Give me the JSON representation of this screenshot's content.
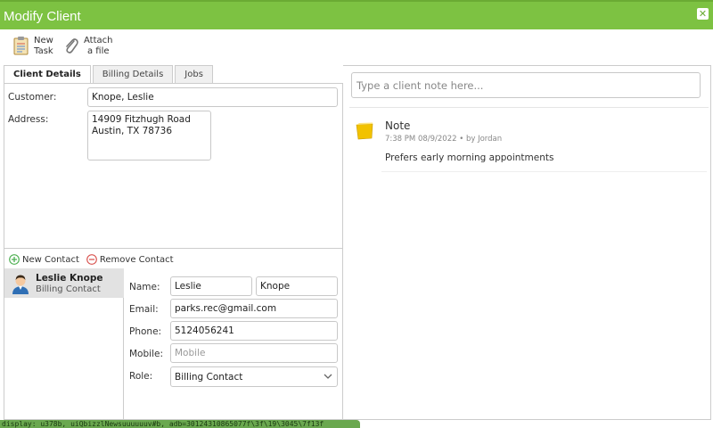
{
  "window": {
    "title": "Modify Client",
    "close_icon": "close-icon"
  },
  "toolbar": {
    "new_task": {
      "label_line1": "New",
      "label_line2": "Task",
      "icon": "clipboard-icon"
    },
    "attach_file": {
      "label_line1": "Attach",
      "label_line2": "a file",
      "icon": "paperclip-icon"
    }
  },
  "tabs": [
    {
      "label": "Client Details",
      "active": true
    },
    {
      "label": "Billing Details",
      "active": false
    },
    {
      "label": "Jobs",
      "active": false
    }
  ],
  "client": {
    "customer_label": "Customer:",
    "customer_value": "Knope, Leslie",
    "address_label": "Address:",
    "address_value": "14909 Fitzhugh Road\nAustin, TX 78736"
  },
  "contacts": {
    "new_contact_label": "New Contact",
    "remove_contact_label": "Remove Contact",
    "list": [
      {
        "name": "Leslie Knope",
        "role": "Billing Contact"
      }
    ],
    "form": {
      "name_label": "Name:",
      "first_name": "Leslie",
      "last_name": "Knope",
      "email_label": "Email:",
      "email": "parks.rec@gmail.com",
      "phone_label": "Phone:",
      "phone": "5124056241",
      "mobile_label": "Mobile:",
      "mobile_placeholder": "Mobile",
      "role_label": "Role:",
      "role_selected": "Billing Contact"
    }
  },
  "notes": {
    "input_placeholder": "Type a client note here...",
    "items": [
      {
        "title": "Note",
        "meta": "7:38 PM 08/9/2022 • by Jordan",
        "body": "Prefers early morning appointments",
        "icon": "sticky-note-icon"
      }
    ]
  },
  "statusbar": {
    "text": "display: u378b, uiQbizzlNewsuuuuuuv#b, adb=30124310865077f\\3f\\19\\3045\\7f13f"
  },
  "colors": {
    "titlebar": "#7dc242",
    "statusbar": "#6aa84f",
    "add": "#4caf50",
    "remove": "#d9534f"
  }
}
